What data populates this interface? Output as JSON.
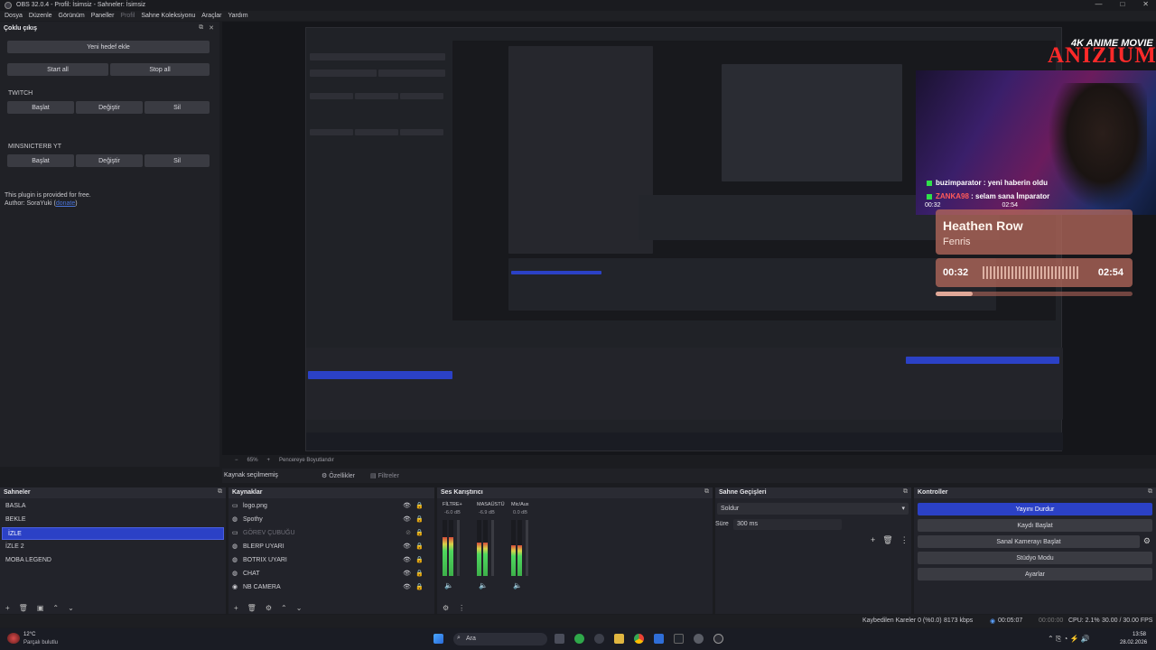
{
  "window": {
    "title": "OBS 32.0.4 - Profil: İsimsiz - Sahneler: İsimsiz",
    "controls": [
      "—",
      "□",
      "✕"
    ]
  },
  "menu": [
    "Dosya",
    "Düzenle",
    "Görünüm",
    "Paneller",
    "Profil",
    "Sahne Koleksiyonu",
    "Araçlar",
    "Yardım"
  ],
  "multi_output": {
    "title": "Çoklu çıkış",
    "add_target": "Yeni hedef ekle",
    "start_all": "Start all",
    "stop_all": "Stop all",
    "targets": [
      {
        "name": "TWITCH",
        "start": "Başlat",
        "edit": "Değiştir",
        "delete": "Sil"
      },
      {
        "name": "MINSNICTERB YT",
        "start": "Başlat",
        "edit": "Değiştir",
        "delete": "Sil"
      }
    ],
    "note1": "This plugin is provided for free.",
    "note2": "Author: SoraYuki (",
    "note2_link": "donate",
    "note2_end": ")"
  },
  "overlay": {
    "brand_top": "4K ANIME MOVIE",
    "brand_main": "ANIZIUM",
    "chat": [
      {
        "user": "buzimparator",
        "msg": "yeni haberin oldu"
      },
      {
        "user": "ZANKA98",
        "msg": "selam sana İmparator"
      }
    ],
    "small_times": "00:32",
    "small_times_end": "02:54",
    "song": "Heathen Row",
    "artist": "Fenris",
    "time_current": "00:32",
    "time_total": "02:54",
    "progress": 0.19
  },
  "preview_strip": {
    "zoom": "65%",
    "fit": "Pencereye Boyutlandır"
  },
  "source_bar": {
    "selected": "Kaynak seçilmemiş",
    "properties": "Özellikler",
    "filters": "Filtreler"
  },
  "scenes": {
    "title": "Sahneler",
    "items": [
      "BASLA",
      "BEKLE",
      "İZLE",
      "İZLE 2",
      "MOBA LEGEND"
    ],
    "selected_index": 2
  },
  "sources": {
    "title": "Kaynaklar",
    "items": [
      {
        "name": "logo.png",
        "icon": "image-icon",
        "visible": true
      },
      {
        "name": "Spothy",
        "icon": "globe-icon",
        "visible": true
      },
      {
        "name": "GÖREV ÇUBUĞU",
        "icon": "window-icon",
        "visible": false
      },
      {
        "name": "BLERP UYARI",
        "icon": "globe-icon",
        "visible": true
      },
      {
        "name": "BOTRIX UYARI",
        "icon": "globe-icon",
        "visible": true
      },
      {
        "name": "CHAT",
        "icon": "globe-icon",
        "visible": true
      },
      {
        "name": "NB CAMERA",
        "icon": "camera-icon",
        "visible": true
      }
    ]
  },
  "audio": {
    "title": "Ses Karıştırıcı",
    "channels": [
      {
        "name": "FİLTRE+",
        "db": "-6.0 dB",
        "level": 0.7
      },
      {
        "name": "MASAÜSTÜ",
        "db": "-6.9 dB",
        "level": 0.6
      },
      {
        "name": "Mic/Aux",
        "db": "0.0 dB",
        "level": 0.55
      }
    ],
    "scale": [
      "0",
      "-5",
      "-10",
      "-15",
      "-20",
      "-25",
      "-30",
      "-35",
      "-40",
      "-45",
      "-50",
      "-55",
      "-60"
    ]
  },
  "transitions": {
    "title": "Sahne Geçişleri",
    "selected": "Soldur",
    "duration_label": "Süre",
    "duration_value": "300 ms"
  },
  "controls": {
    "title": "Kontroller",
    "buttons": [
      "Yayını Durdur",
      "Kaydı Başlat",
      "Sanal Kamerayı Başlat",
      "Stüdyo Modu",
      "Ayarlar"
    ]
  },
  "status": {
    "dropped": "Kaybedilen Kareler 0 (%0.0)",
    "bitrate": "8173 kbps",
    "stream_time": "00:05:07",
    "rec_time": "00:00:00",
    "cpu": "CPU: 2.1%",
    "fps": "30.00 / 30.00 FPS"
  },
  "taskbar": {
    "weather_temp": "12°C",
    "weather_desc": "Parçalı bulutlu",
    "search": "Ara",
    "time": "13:58",
    "date": "28.02.2026"
  },
  "colors": {
    "accent": "#2b41c6",
    "panel": "#22232a",
    "music_card": "#b1665a"
  }
}
